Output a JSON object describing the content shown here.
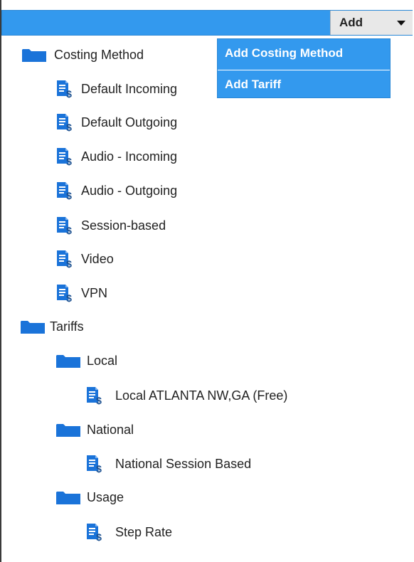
{
  "toolbar": {
    "add_label": "Add"
  },
  "dropdown": {
    "items": [
      {
        "label": "Add Costing Method"
      },
      {
        "label": "Add Tariff"
      }
    ]
  },
  "tree": {
    "costing_method": {
      "label": "Costing Method",
      "children": [
        {
          "label": "Default Incoming"
        },
        {
          "label": "Default Outgoing"
        },
        {
          "label": "Audio - Incoming"
        },
        {
          "label": "Audio - Outgoing"
        },
        {
          "label": "Session-based"
        },
        {
          "label": "Video"
        },
        {
          "label": "VPN"
        }
      ]
    },
    "tariffs": {
      "label": "Tariffs",
      "local": {
        "label": "Local",
        "children": [
          {
            "label": "Local ATLANTA NW,GA (Free)"
          }
        ]
      },
      "national": {
        "label": "National",
        "children": [
          {
            "label": "National Session Based"
          }
        ]
      },
      "usage": {
        "label": "Usage",
        "children": [
          {
            "label": "Step Rate"
          }
        ]
      }
    }
  },
  "colors": {
    "bar": "#3399ee",
    "folder": "#1a73d9",
    "doc": "#1a73d9",
    "dollar": "#1a4f8f"
  },
  "icons": {
    "folder": "folder-icon",
    "document": "tariff-document-icon"
  }
}
